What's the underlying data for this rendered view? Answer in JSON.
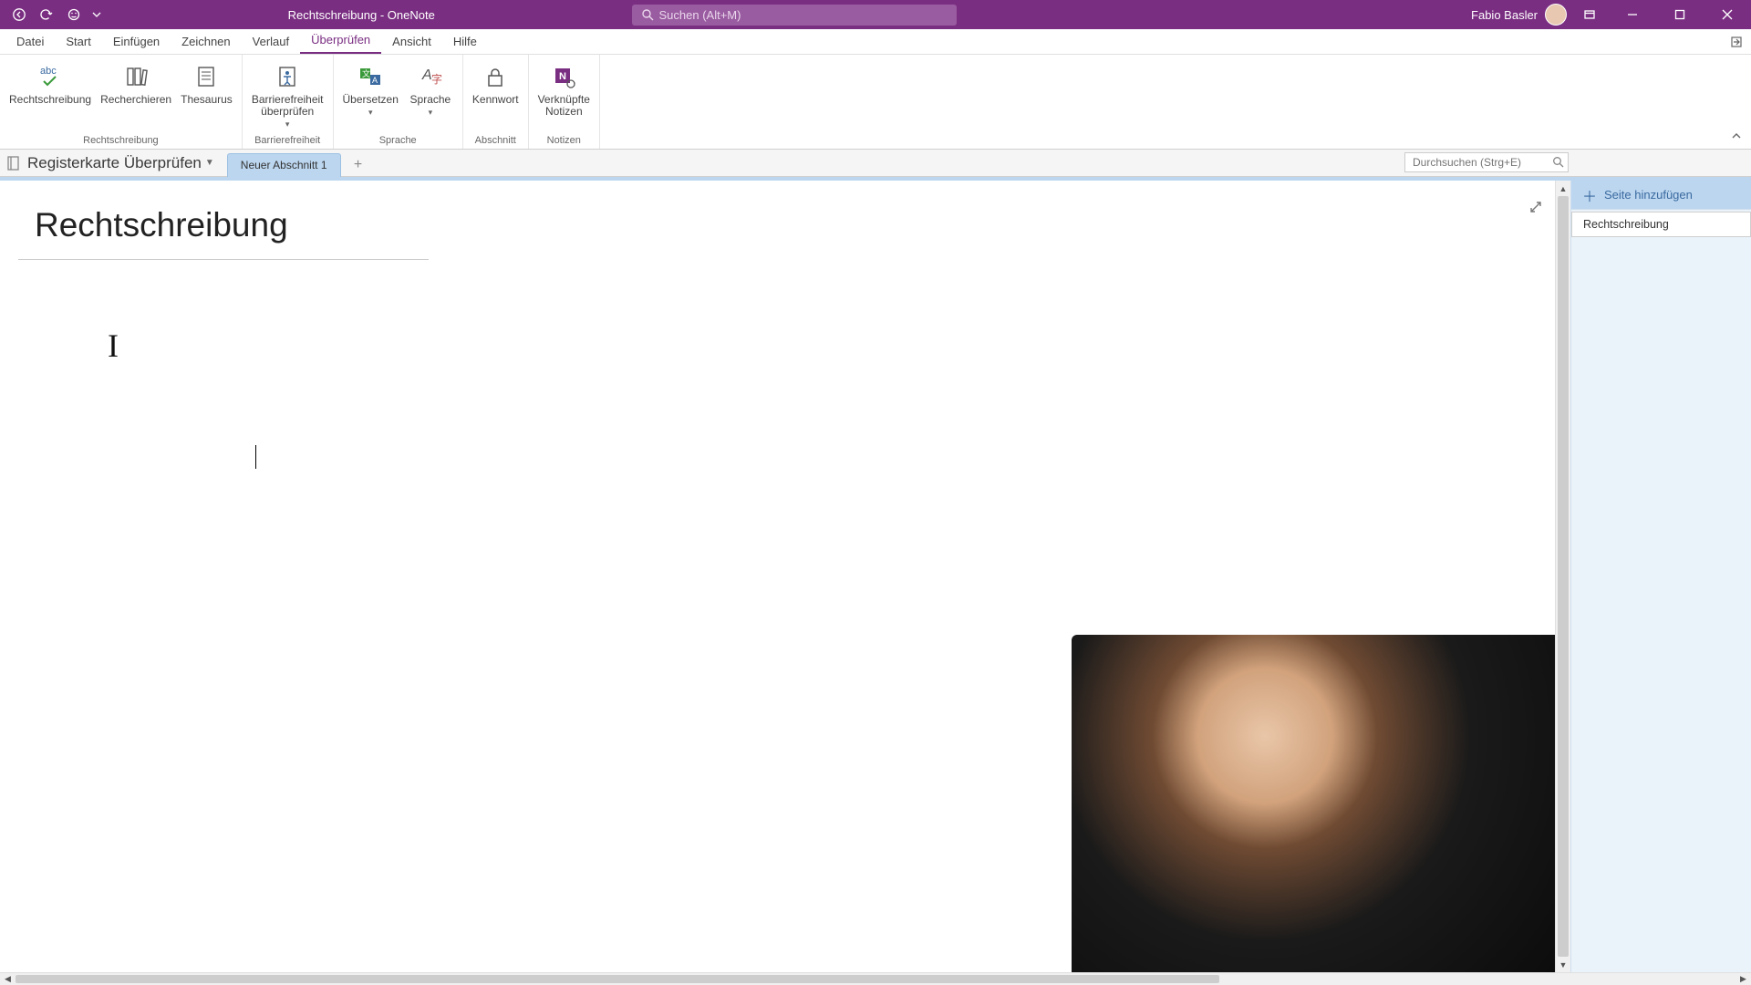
{
  "title_bar": {
    "document_title": "Rechtschreibung  -  OneNote",
    "search_placeholder": "Suchen (Alt+M)",
    "user_name": "Fabio Basler"
  },
  "ribbon_tabs": {
    "items": [
      "Datei",
      "Start",
      "Einfügen",
      "Zeichnen",
      "Verlauf",
      "Überprüfen",
      "Ansicht",
      "Hilfe"
    ],
    "active_index": 5
  },
  "ribbon": {
    "groups": [
      {
        "label": "Rechtschreibung",
        "buttons": [
          {
            "label": "Rechtschreibung",
            "icon": "abc-check-icon"
          },
          {
            "label": "Recherchieren",
            "icon": "books-icon"
          },
          {
            "label": "Thesaurus",
            "icon": "thesaurus-icon"
          }
        ]
      },
      {
        "label": "Barrierefreiheit",
        "buttons": [
          {
            "label": "Barrierefreiheit\nüberprüfen",
            "icon": "accessibility-icon",
            "dropdown": true
          }
        ]
      },
      {
        "label": "Sprache",
        "buttons": [
          {
            "label": "Übersetzen",
            "icon": "translate-icon",
            "dropdown": true
          },
          {
            "label": "Sprache",
            "icon": "language-icon",
            "dropdown": true
          }
        ]
      },
      {
        "label": "Abschnitt",
        "buttons": [
          {
            "label": "Kennwort",
            "icon": "lock-icon"
          }
        ]
      },
      {
        "label": "Notizen",
        "buttons": [
          {
            "label": "Verknüpfte\nNotizen",
            "icon": "onenote-link-icon"
          }
        ]
      }
    ]
  },
  "notebook": {
    "name": "Registerkarte Überprüfen",
    "section_tab": "Neuer Abschnitt 1",
    "mini_search_placeholder": "Durchsuchen (Strg+E)"
  },
  "page": {
    "title": "Rechtschreibung",
    "body_text": "I"
  },
  "page_panel": {
    "add_label": "Seite hinzufügen",
    "pages": [
      "Rechtschreibung"
    ]
  },
  "colors": {
    "brand": "#7a2e82",
    "section": "#bcd6ef"
  }
}
